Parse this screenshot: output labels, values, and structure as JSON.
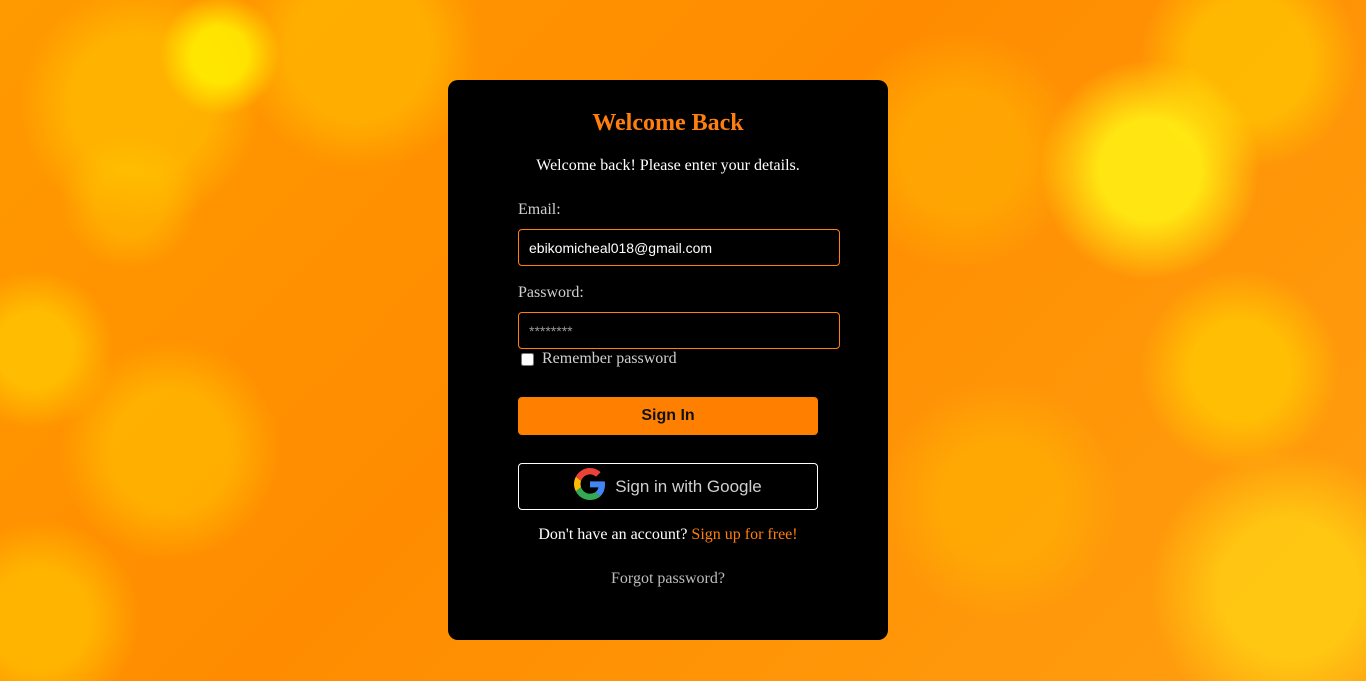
{
  "login": {
    "title": "Welcome Back",
    "subtitle": "Welcome back! Please enter your details.",
    "email_label": "Email:",
    "email_value": "ebikomicheal018@gmail.com",
    "password_label": "Password:",
    "password_placeholder": "********",
    "remember_label": "Remember password",
    "remember_checked": false,
    "signin_label": "Sign In",
    "google_label": "Sign in with Google",
    "google_icon": "google-g-icon",
    "signup_prompt": "Don't have an account?",
    "signup_link": "Sign up for free!",
    "forgot_link": "Forgot password?"
  },
  "colors": {
    "accent": "#ff7f0e",
    "card": "#000000",
    "background": "#ff9000"
  }
}
